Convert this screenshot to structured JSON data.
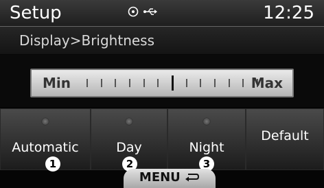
{
  "header": {
    "title": "Setup",
    "time": "12:25",
    "status_icons": [
      "disc-icon",
      "usb-icon"
    ]
  },
  "breadcrumb": "Display>Brightness",
  "brightness": {
    "min_label": "Min",
    "max_label": "Max",
    "tick_count": 13,
    "level_fraction": 0.5
  },
  "modes": [
    {
      "label": "Automatic",
      "callout": "1"
    },
    {
      "label": "Day",
      "callout": "2"
    },
    {
      "label": "Night",
      "callout": "3"
    }
  ],
  "default_label": "Default",
  "menu_label": "MENU"
}
